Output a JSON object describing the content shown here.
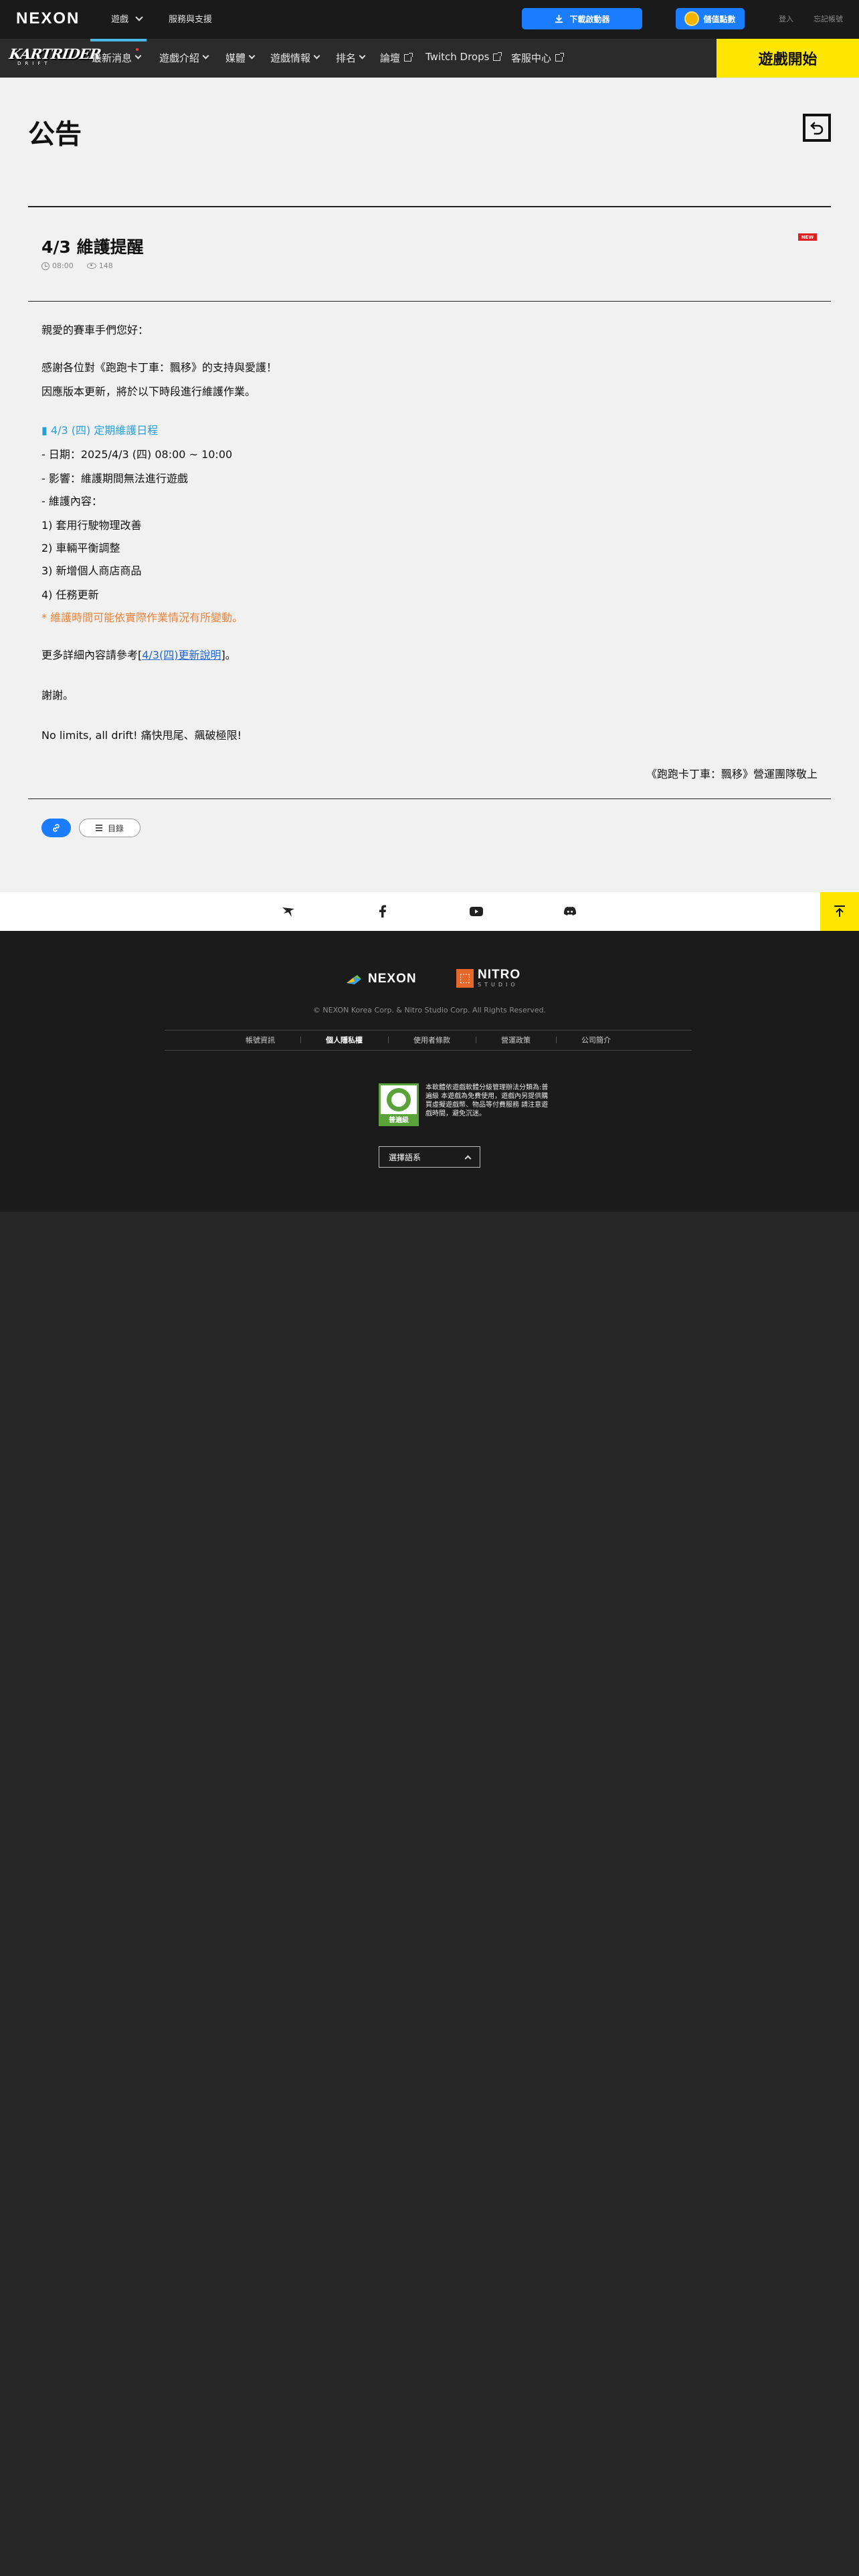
{
  "topbar": {
    "logo": "NEXON",
    "nav_games": "遊戲",
    "nav_support": "服務與支援",
    "download_label": "下載啟動器",
    "recharge_label": "儲值點數",
    "login": "登入",
    "forgot": "忘記帳號"
  },
  "gamenav": {
    "logo_text": "KARTRIDER",
    "logo_sub": "DRIFT",
    "items": [
      {
        "label": "最新消息"
      },
      {
        "label": "遊戲介紹"
      },
      {
        "label": "媒體"
      },
      {
        "label": "遊戲情報"
      },
      {
        "label": "排名"
      },
      {
        "label": "論壇"
      },
      {
        "label": "Twitch Drops"
      },
      {
        "label": "客服中心"
      }
    ],
    "start_label": "遊戲開始"
  },
  "page": {
    "title": "公告"
  },
  "post": {
    "title": "4/3 維護提醒",
    "badge": "NEW",
    "time": "08:00",
    "views": "148",
    "lines": [
      "親愛的賽車手們您好：",
      "感謝各位對《跑跑卡丁車：飄移》的支持與愛護！",
      "因應版本更新，將於以下時段進行維護作業。",
      "▮ 4/3 (四) 定期維護日程",
      "- 日期：2025/4/3 (四) 08:00 ~ 10:00",
      "- 影響：維護期間無法進行遊戲",
      "- 維護內容：",
      "1) 套用行駛物理改善",
      "2) 車輛平衡調整",
      "3) 新增個人商店商品",
      "4) 任務更新",
      "* 維護時間可能依實際作業情況有所變動。",
      "謝謝。",
      "No limits, all drift! 痛快甩尾、飆破極限!"
    ],
    "more_prefix": "更多詳細內容請參考[",
    "more_link": "4/3(四)更新說明",
    "more_suffix": "]。",
    "signature": "《跑跑卡丁車：飄移》營運團隊敬上",
    "list_label": "目錄"
  },
  "social": {
    "icons": [
      "kartrider-icon",
      "facebook-icon",
      "youtube-icon",
      "discord-icon"
    ]
  },
  "footer": {
    "nexon": "NEXON",
    "nitro_1": "NITRO",
    "nitro_2": "STUDIO",
    "copyright": "© NEXON Korea Corp. & Nitro Studio Corp. All Rights Reserved.",
    "links": [
      {
        "label": "帳號資訊"
      },
      {
        "label": "個人隱私權"
      },
      {
        "label": "使用者條款"
      },
      {
        "label": "營運政策"
      },
      {
        "label": "公司簡介"
      }
    ],
    "rating_label": "普遍級",
    "rating_text": "本軟體依遊戲軟體分級管理辦法分類為:普遍級 本遊戲為免費使用，遊戲內另提供購買虛擬遊戲幣、物品等付費服務 請注意遊戲時間，避免沉迷。",
    "lang_label": "選擇語系"
  },
  "colors": {
    "accent_yellow": "#ffe600",
    "accent_blue": "#1a7cff",
    "highlight_blue": "#2a9fd6",
    "warning_orange": "#e8823a"
  }
}
